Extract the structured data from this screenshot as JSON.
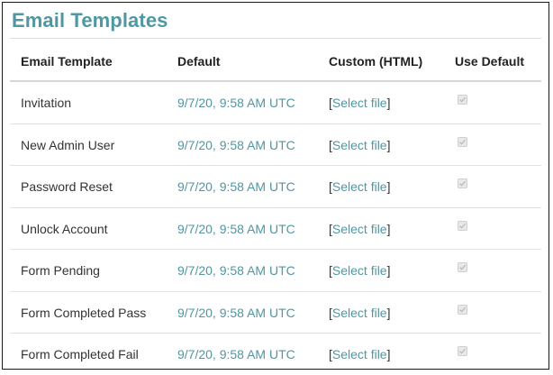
{
  "page": {
    "title": "Email Templates"
  },
  "table": {
    "headers": {
      "template": "Email Template",
      "default": "Default",
      "custom": "Custom (HTML)",
      "use_default": "Use Default"
    },
    "rows": [
      {
        "name": "Invitation",
        "default": "9/7/20, 9:58 AM UTC",
        "custom_open": "[",
        "custom_link": "Select file",
        "custom_close": "]",
        "use_default": true
      },
      {
        "name": "New Admin User",
        "default": "9/7/20, 9:58 AM UTC",
        "custom_open": "[",
        "custom_link": "Select file",
        "custom_close": "]",
        "use_default": true
      },
      {
        "name": "Password Reset",
        "default": "9/7/20, 9:58 AM UTC",
        "custom_open": "[",
        "custom_link": "Select file",
        "custom_close": "]",
        "use_default": true
      },
      {
        "name": "Unlock Account",
        "default": "9/7/20, 9:58 AM UTC",
        "custom_open": "[",
        "custom_link": "Select file",
        "custom_close": "]",
        "use_default": true
      },
      {
        "name": "Form Pending",
        "default": "9/7/20, 9:58 AM UTC",
        "custom_open": "[",
        "custom_link": "Select file",
        "custom_close": "]",
        "use_default": true
      },
      {
        "name": "Form Completed Pass",
        "default": "9/7/20, 9:58 AM UTC",
        "custom_open": "[",
        "custom_link": "Select file",
        "custom_close": "]",
        "use_default": true
      },
      {
        "name": "Form Completed Fail",
        "default": "9/7/20, 9:58 AM UTC",
        "custom_open": "[",
        "custom_link": "Select file",
        "custom_close": "]",
        "use_default": true
      }
    ]
  },
  "colors": {
    "accent": "#4f97a3",
    "text": "#333333",
    "checkbox_disabled": "#e9e9e9"
  },
  "icons": {
    "checkbox": "check-icon"
  }
}
